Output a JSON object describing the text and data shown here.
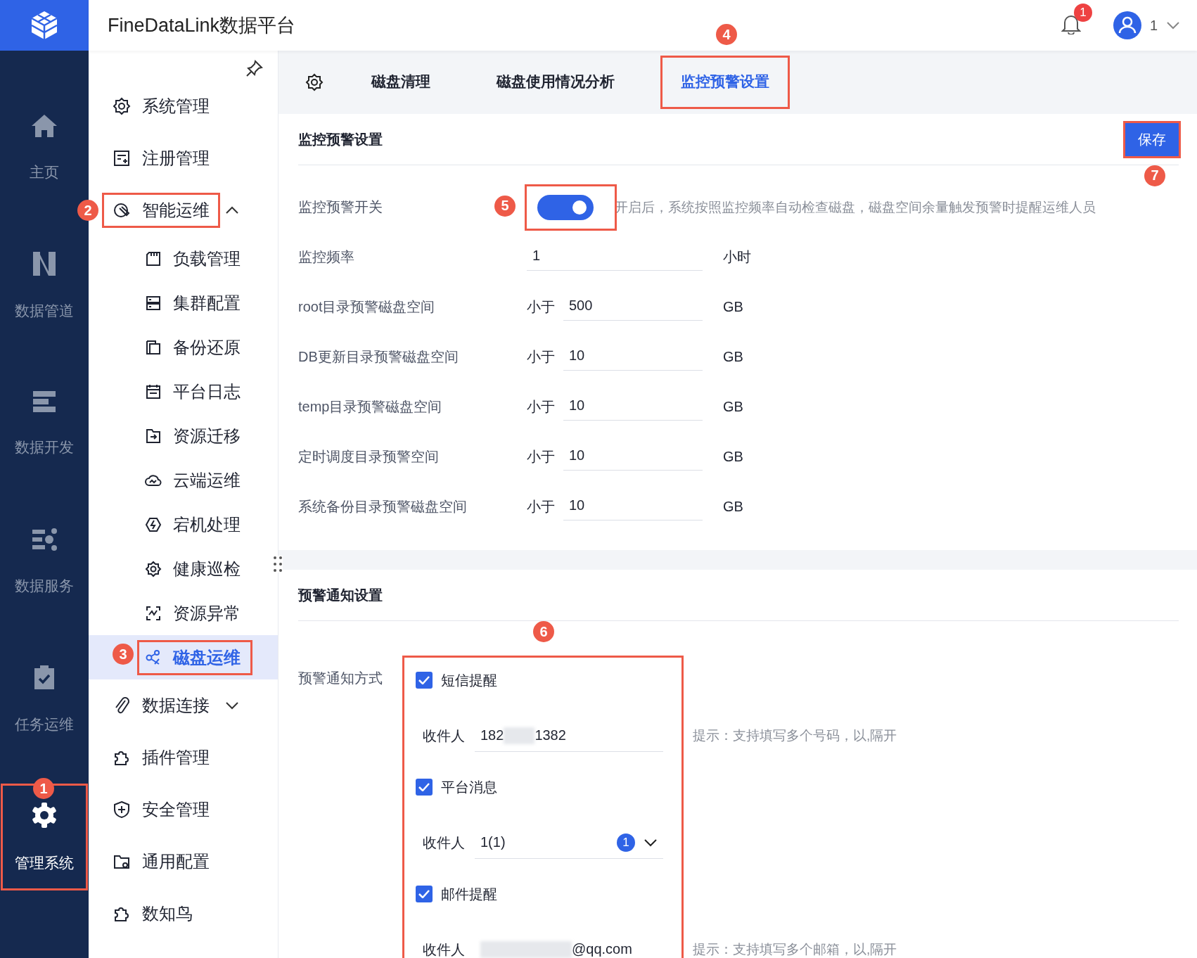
{
  "header": {
    "title": "FineDataLink数据平台",
    "notification_count": "1",
    "user": "1"
  },
  "nav_rail": [
    {
      "label": "主页",
      "selected": false
    },
    {
      "label": "数据管道",
      "selected": false
    },
    {
      "label": "数据开发",
      "selected": false
    },
    {
      "label": "数据服务",
      "selected": false
    },
    {
      "label": "任务运维",
      "selected": false
    },
    {
      "label": "管理系统",
      "selected": true,
      "callout": "1"
    }
  ],
  "menu": [
    {
      "label": "系统管理",
      "selected": false
    },
    {
      "label": "注册管理",
      "selected": false
    },
    {
      "label": "智能运维",
      "selected": false,
      "expanded": true,
      "callout": "2",
      "children": [
        {
          "label": "负载管理",
          "selected": false
        },
        {
          "label": "集群配置",
          "selected": false
        },
        {
          "label": "备份还原",
          "selected": false
        },
        {
          "label": "平台日志",
          "selected": false
        },
        {
          "label": "资源迁移",
          "selected": false
        },
        {
          "label": "云端运维",
          "selected": false
        },
        {
          "label": "宕机处理",
          "selected": false
        },
        {
          "label": "健康巡检",
          "selected": false
        },
        {
          "label": "资源异常",
          "selected": false
        },
        {
          "label": "磁盘运维",
          "selected": true,
          "callout": "3"
        }
      ]
    },
    {
      "label": "数据连接",
      "selected": false,
      "expanded": false
    },
    {
      "label": "插件管理",
      "selected": false
    },
    {
      "label": "安全管理",
      "selected": false
    },
    {
      "label": "通用配置",
      "selected": false
    },
    {
      "label": "数知鸟",
      "selected": false
    }
  ],
  "tabs": [
    {
      "label": "磁盘清理",
      "selected": false
    },
    {
      "label": "磁盘使用情况分析",
      "selected": false
    },
    {
      "label": "监控预警设置",
      "selected": true,
      "callout": "4"
    }
  ],
  "monitor_section": {
    "title": "监控预警设置",
    "save_button": {
      "label": "保存",
      "callout": "7"
    },
    "toggle": {
      "label": "监控预警开关",
      "on": true,
      "callout": "5",
      "hint": "开启后，系统按照监控频率自动检查磁盘，磁盘空间余量触发预警时提醒运维人员"
    },
    "fields": [
      {
        "label": "监控频率",
        "value": "1",
        "unit": "小时"
      },
      {
        "label": "root目录预警磁盘空间",
        "prefix": "小于",
        "value": "500",
        "unit": "GB"
      },
      {
        "label": "DB更新目录预警磁盘空间",
        "prefix": "小于",
        "value": "10",
        "unit": "GB"
      },
      {
        "label": "temp目录预警磁盘空间",
        "prefix": "小于",
        "value": "10",
        "unit": "GB"
      },
      {
        "label": "定时调度目录预警空间",
        "prefix": "小于",
        "value": "10",
        "unit": "GB"
      },
      {
        "label": "系统备份目录预警磁盘空间",
        "prefix": "小于",
        "value": "10",
        "unit": "GB"
      }
    ]
  },
  "notify_section": {
    "title": "预警通知设置",
    "label": "预警通知方式",
    "callout": "6",
    "methods": [
      {
        "kind": "text",
        "label": "短信提醒",
        "checked": true,
        "recipient_label": "收件人",
        "value_start": "182",
        "value_end": "1382",
        "hint": "提示：支持填写多个号码，以,隔开"
      },
      {
        "kind": "select",
        "label": "平台消息",
        "checked": true,
        "recipient_label": "收件人",
        "value": "1(1)",
        "count": "1"
      },
      {
        "kind": "text",
        "label": "邮件提醒",
        "checked": true,
        "recipient_label": "收件人",
        "value_end": "@qq.com",
        "hint": "提示：支持填写多个邮箱，以,隔开"
      }
    ]
  }
}
